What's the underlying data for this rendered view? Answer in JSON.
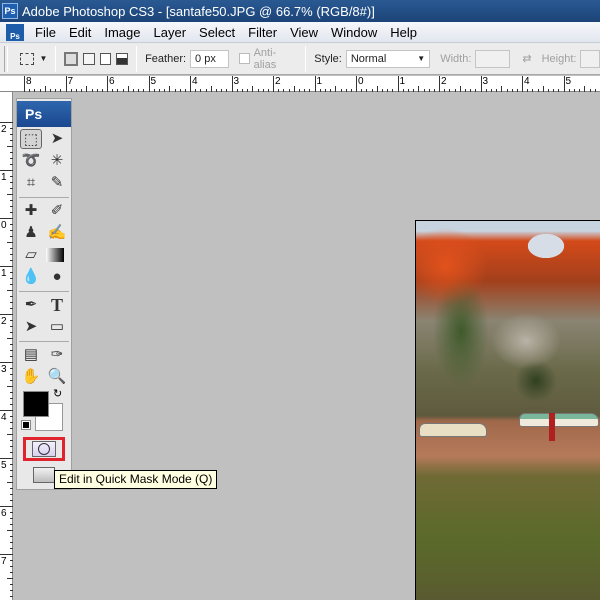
{
  "titlebar": {
    "title": "Adobe Photoshop CS3 - [santafe50.JPG @ 66.7% (RGB/8#)]",
    "icon": "Ps"
  },
  "menu": {
    "icon": "Ps",
    "items": [
      "File",
      "Edit",
      "Image",
      "Layer",
      "Select",
      "Filter",
      "View",
      "Window",
      "Help"
    ]
  },
  "options": {
    "feather_label": "Feather:",
    "feather_value": "0 px",
    "antialias_label": "Anti-alias",
    "style_label": "Style:",
    "style_value": "Normal",
    "width_label": "Width:",
    "height_label": "Height:"
  },
  "ruler_top": [
    "8",
    "7",
    "6",
    "5",
    "4",
    "3",
    "2",
    "1",
    "0",
    "1",
    "2",
    "3",
    "4",
    "5"
  ],
  "ruler_left": [
    "2",
    "1",
    "0",
    "1",
    "2",
    "3",
    "4",
    "5",
    "6",
    "7"
  ],
  "toolbox": {
    "header": "Ps",
    "type_tool": "T"
  },
  "tooltip": "Edit in Quick Mask Mode (Q)",
  "colors": {
    "highlight": "#e0232c",
    "foreground": "#000000",
    "background": "#ffffff"
  }
}
